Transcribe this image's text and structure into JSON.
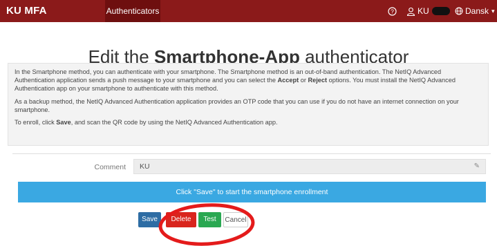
{
  "topbar": {
    "brand": "KU MFA",
    "nav_tab": "Authenticators",
    "help_icon": "question-circle-icon",
    "user_icon": "user-icon",
    "user_name": "KU",
    "language_icon": "globe-icon",
    "language": "Dansk",
    "background_color": "#8b1a1a"
  },
  "page": {
    "title_prefix": "Edit the",
    "title_bold": "Smartphone-App",
    "title_suffix": "authenticator"
  },
  "info": {
    "p1_a": "In the Smartphone method, you can authenticate with your smartphone. The Smartphone method is an out-of-band authentication. The NetIQ Advanced Authentication application sends a push message to your smartphone and you can select the",
    "p1_accept": "Accept",
    "p1_or": "or",
    "p1_reject": "Reject",
    "p1_b": "options. You must install the NetIQ Advanced Authentication app on your smartphone to authenticate with this method.",
    "p2": "As a backup method, the NetIQ Advanced Authentication application provides an OTP code that you can use if you do not have an internet connection on your smartphone.",
    "p3_a": "To enroll, click",
    "p3_save": "Save",
    "p3_b": ", and scan the QR code by using the NetIQ Advanced Authentication app."
  },
  "form": {
    "comment_label": "Comment",
    "comment_value": "KU",
    "edit_icon": "edit-icon"
  },
  "banner": {
    "text": "Click \"Save\" to start the smartphone enrollment",
    "color": "#3aa8e2"
  },
  "buttons": {
    "save": "Save",
    "delete": "Delete",
    "test": "Test",
    "cancel": "Cancel"
  },
  "annotation": {
    "color": "#e41b1b"
  }
}
